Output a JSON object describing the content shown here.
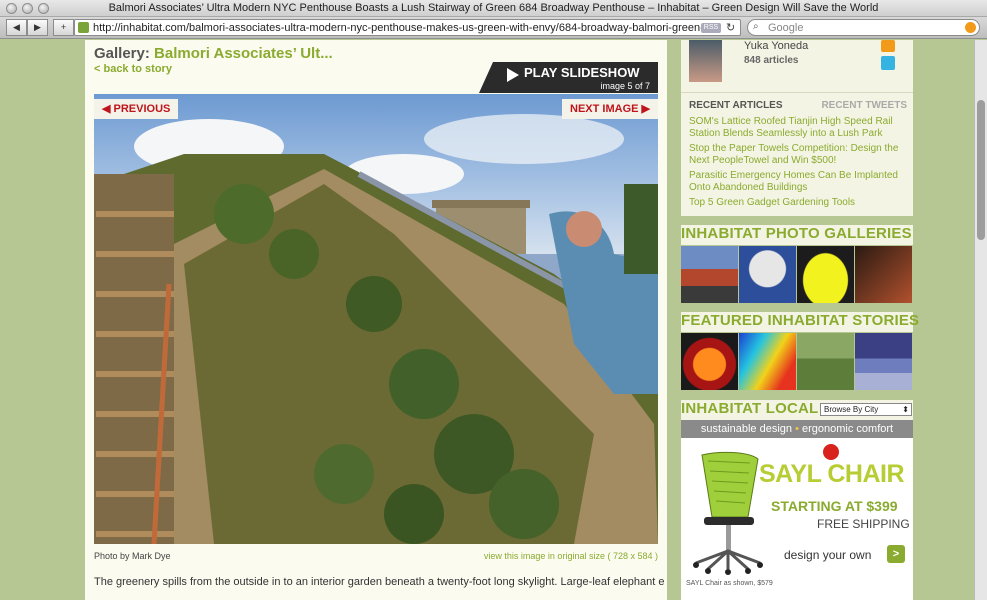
{
  "browser": {
    "window_title": "Balmori Associates’ Ultra Modern NYC Penthouse Boasts a Lush Stairway of Green 684 Broadway Penthouse – Inhabitat – Green Design Will Save the World",
    "url": "http://inhabitat.com/balmori-associates-ultra-modern-nyc-penthouse-makes-us-green-with-envy/684-broadway-balmori-green-",
    "rss_badge": "RSS",
    "search_placeholder": "Google",
    "back_glyph": "◀",
    "forward_glyph": "▶",
    "add_glyph": "+",
    "reload_glyph": "↻",
    "search_glyph": "⌕"
  },
  "gallery": {
    "label": "Gallery:",
    "title": "Balmori Associates’ Ult...",
    "back_link": "< back to story",
    "slideshow_label": "PLAY SLIDESHOW",
    "counter": "image 5 of 7",
    "previous": "◀ PREVIOUS",
    "next": "NEXT IMAGE ▶",
    "credit": "Photo by Mark Dye",
    "original_size": "view this image in original size ( 728 x 584 )",
    "caption": "The greenery spills from the outside in to an interior garden beneath a twenty-foot long skylight. Large-leaf elephant ears and"
  },
  "sidebar": {
    "author_name": "Yuka Yoneda",
    "author_count": "848 articles",
    "tabs": {
      "active": "RECENT ARTICLES",
      "inactive": "RECENT TWEETS"
    },
    "articles": [
      "SOM's Lattice Roofed Tianjin High Speed Rail Station Blends Seamlessly into a Lush Park",
      "Stop the Paper Towels Competition: Design the Next PeopleTowel and Win $500!",
      "Parasitic Emergency Homes Can Be Implanted Onto Abandoned Buildings",
      "Top 5 Green Gadget Gardening Tools"
    ],
    "photo_galleries": "INHABITAT PHOTO GALLERIES",
    "featured_stories": "FEATURED INHABITAT STORIES",
    "local": "INHABITAT LOCAL",
    "browse_by_city": "Browse By City",
    "select_arrow": "⬍",
    "banner_left": "sustainable design",
    "banner_dot": "•",
    "banner_right": "ergonomic comfort",
    "ad": {
      "title": "SAYL CHAIR",
      "price": "STARTING AT $399",
      "shipping": "FREE SHIPPING",
      "cta": "design your own",
      "cta_glyph": ">",
      "footnote": "SAYL Chair as shown, $579"
    }
  },
  "colors": {
    "accent_green": "#8aab2f",
    "page_bg": "#b7c794",
    "red": "#c0141b"
  }
}
